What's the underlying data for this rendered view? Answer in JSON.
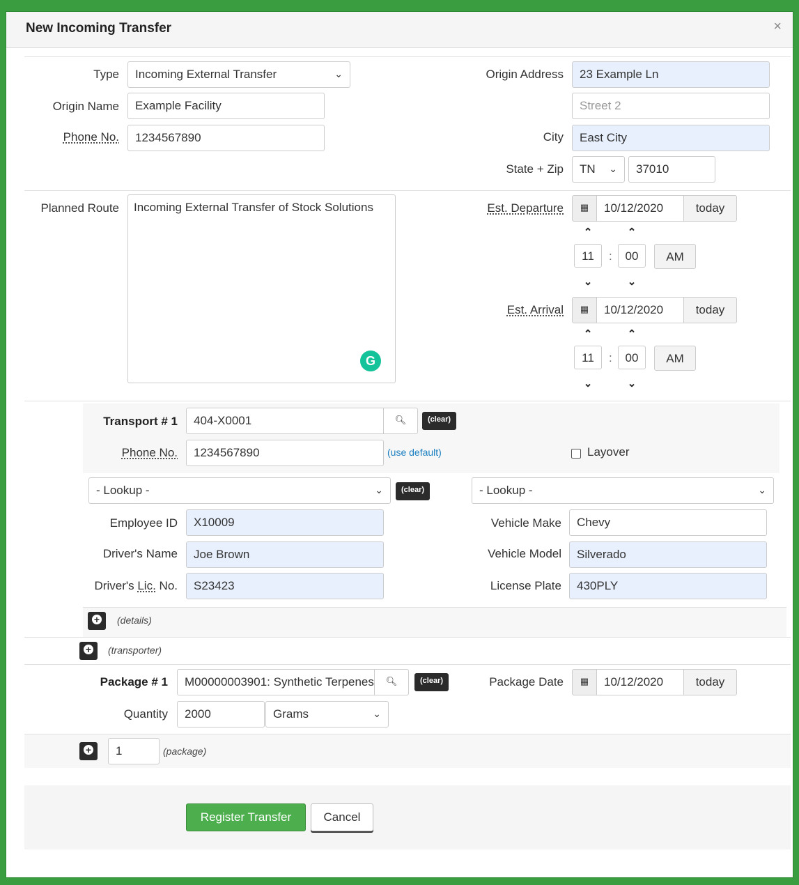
{
  "dialog": {
    "title": "New Incoming Transfer",
    "close_label": "×"
  },
  "icons": {
    "calendar": "calendar-icon",
    "search": "search-icon",
    "plus": "plus-icon",
    "chevron_up": "chevron-up-icon",
    "chevron_down": "chevron-down-icon"
  },
  "colors": {
    "accent_green": "#4cae4c",
    "autofill_blue": "#e8f0fe",
    "link_blue": "#1a7fc1"
  },
  "origin": {
    "type_label": "Type",
    "type_value": "Incoming External Transfer",
    "name_label": "Origin Name",
    "name_value": "Example Facility",
    "phone_label": "Phone No.",
    "phone_value": "1234567890",
    "address_label": "Origin Address",
    "address_value": "23 Example Ln",
    "street2_placeholder": "Street 2",
    "city_label": "City",
    "city_value": "East City",
    "state_zip_label": "State + Zip",
    "state_value": "TN",
    "zip_value": "37010"
  },
  "route": {
    "label": "Planned Route",
    "value": "Incoming External Transfer of Stock Solutions",
    "grammarly_glyph": "G",
    "departure_label": "Est. Departure",
    "departure_date": "10/12/2020",
    "departure_today": "today",
    "departure_hour": "11",
    "departure_minute": "00",
    "departure_ampm": "AM",
    "arrival_label": "Est. Arrival",
    "arrival_date": "10/12/2020",
    "arrival_today": "today",
    "arrival_hour": "11",
    "arrival_minute": "00",
    "arrival_ampm": "AM",
    "time_separator": ":"
  },
  "transport": {
    "label": "Transport # 1",
    "value": "404-X0001",
    "clear": "(clear)",
    "phone_label": "Phone No.",
    "phone_value": "1234567890",
    "use_default": "(use default)",
    "layover_label": "Layover",
    "driver_lookup": "- Lookup -",
    "driver_clear": "(clear)",
    "vehicle_lookup": "- Lookup -",
    "employee_id_label": "Employee ID",
    "employee_id_value": "X10009",
    "driver_name_label": "Driver's Name",
    "driver_name_value": "Joe Brown",
    "driver_lic_label_pre": "Driver's ",
    "driver_lic_label_abbr": "Lic.",
    "driver_lic_label_post": " No.",
    "driver_lic_value": "S23423",
    "vehicle_make_label": "Vehicle Make",
    "vehicle_make_value": "Chevy",
    "vehicle_model_label": "Vehicle Model",
    "vehicle_model_value": "Silverado",
    "license_plate_label": "License Plate",
    "license_plate_value": "430PLY",
    "details_label": "(details)",
    "transporter_label": "(transporter)"
  },
  "package": {
    "label": "Package # 1",
    "value": "M00000003901: Synthetic Terpenes",
    "clear": "(clear)",
    "date_label": "Package Date",
    "date_value": "10/12/2020",
    "date_today": "today",
    "quantity_label": "Quantity",
    "quantity_value": "2000",
    "unit_value": "Grams",
    "add_count": "1",
    "add_label": "(package)"
  },
  "actions": {
    "register": "Register Transfer",
    "cancel": "Cancel"
  }
}
